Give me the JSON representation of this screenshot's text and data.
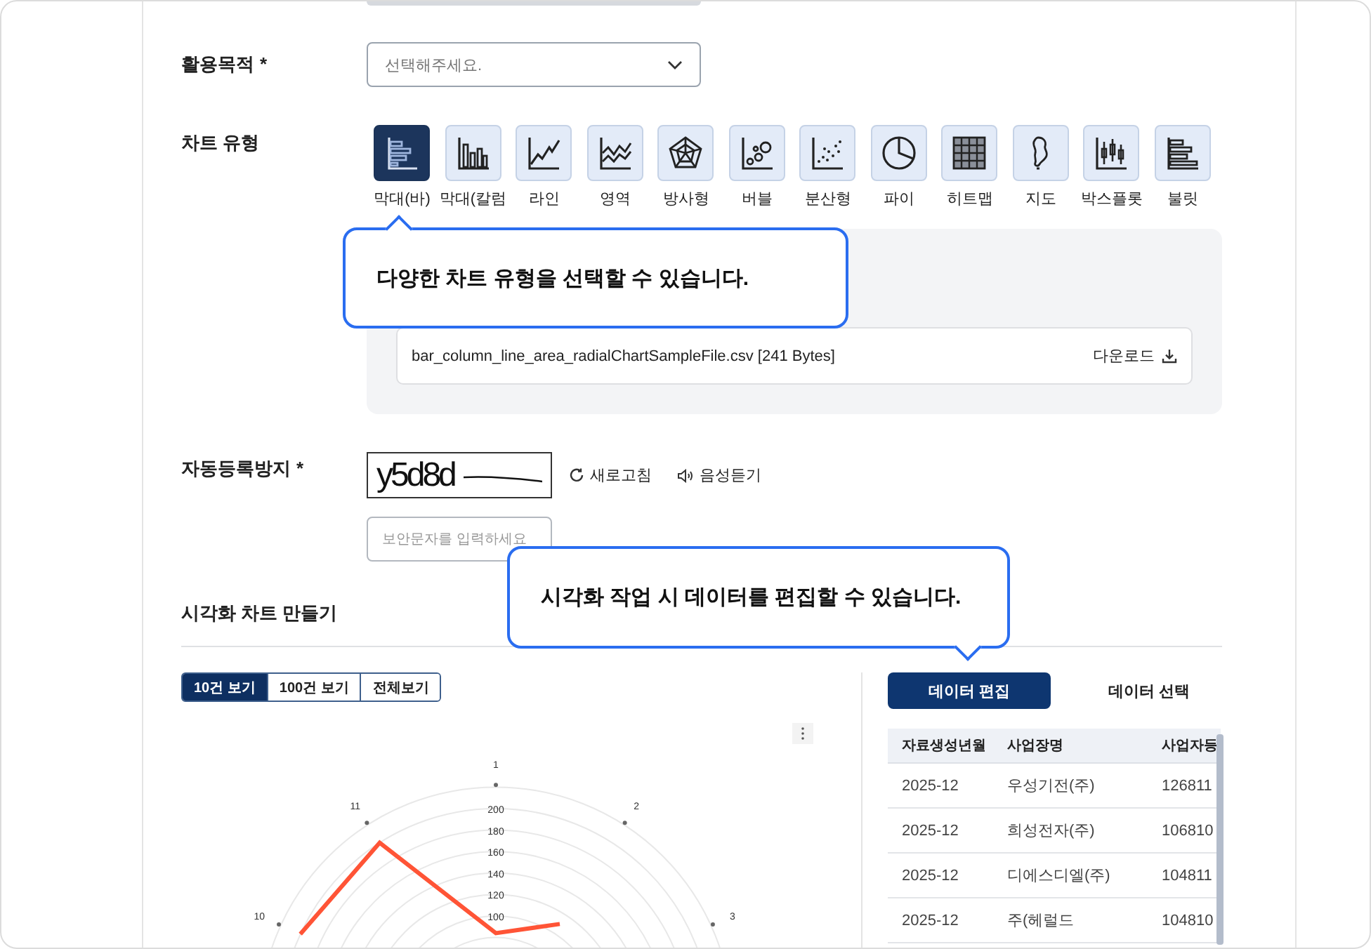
{
  "purpose": {
    "label": "활용목적",
    "required_mark": "*",
    "placeholder": "선택해주세요."
  },
  "chart_type": {
    "label": "차트 유형",
    "types": [
      {
        "kind": "bar",
        "label": "막대(바)",
        "selected": true
      },
      {
        "kind": "column",
        "label": "막대(칼럼",
        "selected": false
      },
      {
        "kind": "line",
        "label": "라인",
        "selected": false
      },
      {
        "kind": "area",
        "label": "영역",
        "selected": false
      },
      {
        "kind": "radial",
        "label": "방사형",
        "selected": false
      },
      {
        "kind": "bubble",
        "label": "버블",
        "selected": false
      },
      {
        "kind": "scatter",
        "label": "분산형",
        "selected": false
      },
      {
        "kind": "pie",
        "label": "파이",
        "selected": false
      },
      {
        "kind": "heatmap",
        "label": "히트맵",
        "selected": false
      },
      {
        "kind": "map",
        "label": "지도",
        "selected": false
      },
      {
        "kind": "boxplot",
        "label": "박스플롯",
        "selected": false
      },
      {
        "kind": "bullet",
        "label": "불릿",
        "selected": false
      }
    ]
  },
  "sample_file": {
    "name": "bar_column_line_area_radialChartSampleFile.csv [241 Bytes]",
    "download": "다운로드"
  },
  "captcha": {
    "label": "자동등록방지",
    "required_mark": "*",
    "code": "y5d8d",
    "refresh": "새로고침",
    "audio": "음성듣기",
    "placeholder": "보안문자를 입력하세요"
  },
  "section_title": "시각화 차트 만들기",
  "view_buttons": [
    {
      "label": "10건 보기",
      "selected": true
    },
    {
      "label": "100건 보기",
      "selected": false
    },
    {
      "label": "전체보기",
      "selected": false
    }
  ],
  "chart": {
    "axis_labels": [
      "1",
      "2",
      "3",
      "10",
      "11"
    ],
    "tick_labels": [
      "200",
      "180",
      "160",
      "140",
      "120",
      "100"
    ]
  },
  "data_tabs": [
    {
      "label": "데이터 편집",
      "selected": true
    },
    {
      "label": "데이터 선택",
      "selected": false
    }
  ],
  "table": {
    "columns": [
      "자료생성년월",
      "사업장명",
      "사업자등"
    ],
    "rows": [
      [
        "2025-12",
        "우성기전(주)",
        "126811"
      ],
      [
        "2025-12",
        "희성전자(주)",
        "106810"
      ],
      [
        "2025-12",
        "디에스디엘(주)",
        "104811"
      ],
      [
        "2025-12",
        "주(헤럴드",
        "104810"
      ]
    ]
  },
  "tooltips": [
    {
      "text": "다양한 차트 유형을 선택할 수 있습니다."
    },
    {
      "text": "시각화 작업 시 데이터를 편집할 수 있습니다."
    }
  ]
}
